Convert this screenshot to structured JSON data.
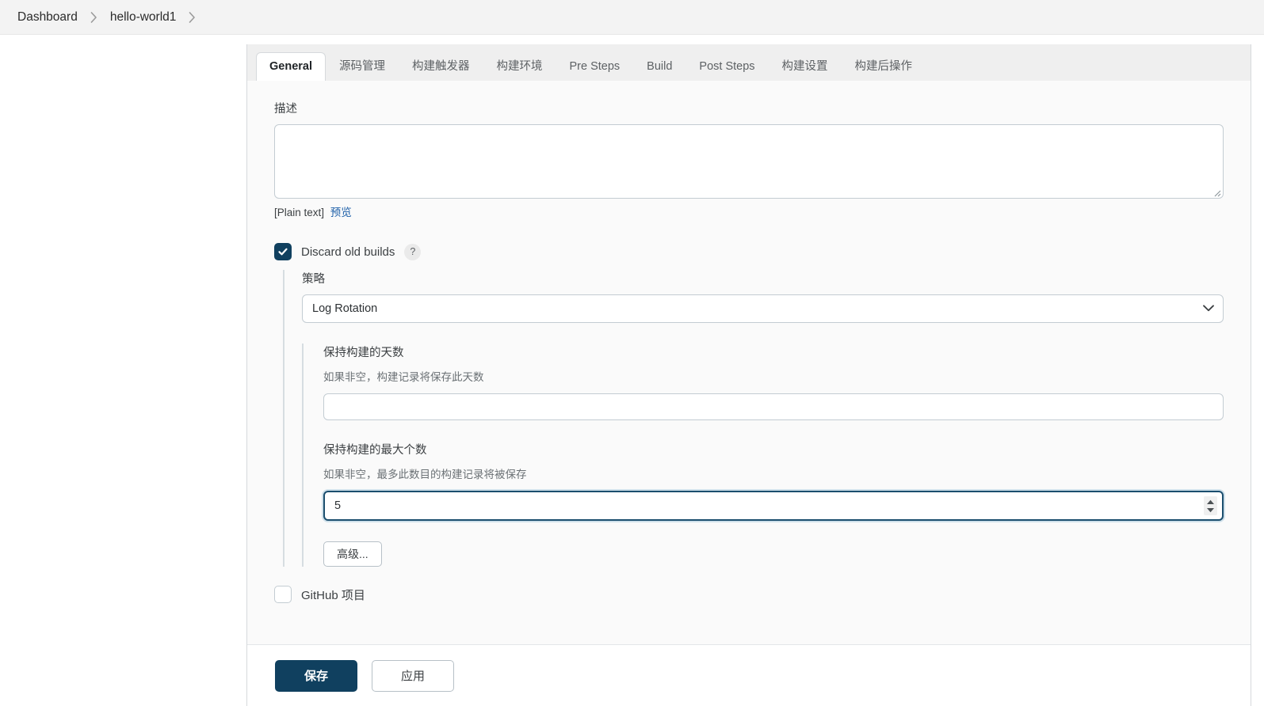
{
  "breadcrumb": {
    "items": [
      {
        "label": "Dashboard"
      },
      {
        "label": "hello-world1"
      }
    ]
  },
  "tabs": [
    {
      "label": "General",
      "active": true
    },
    {
      "label": "源码管理",
      "active": false
    },
    {
      "label": "构建触发器",
      "active": false
    },
    {
      "label": "构建环境",
      "active": false
    },
    {
      "label": "Pre Steps",
      "active": false
    },
    {
      "label": "Build",
      "active": false
    },
    {
      "label": "Post Steps",
      "active": false
    },
    {
      "label": "构建设置",
      "active": false
    },
    {
      "label": "构建后操作",
      "active": false
    }
  ],
  "form": {
    "description": {
      "label": "描述",
      "value": "",
      "placeholder": "",
      "plain_text_note": "[Plain text]",
      "preview_link": "预览"
    },
    "discard_old_builds": {
      "label": "Discard old builds",
      "checked": true,
      "help_glyph": "?"
    },
    "strategy": {
      "label": "策略",
      "selected": "Log Rotation",
      "options": [
        "Log Rotation"
      ]
    },
    "days_to_keep": {
      "label": "保持构建的天数",
      "description": "如果非空，构建记录将保存此天数",
      "value": "",
      "placeholder": ""
    },
    "max_builds_to_keep": {
      "label": "保持构建的最大个数",
      "description": "如果非空，最多此数目的构建记录将被保存",
      "value": "5",
      "placeholder": "",
      "focused": true
    },
    "advanced_button": "高级...",
    "github_project": {
      "label": "GitHub 项目",
      "checked": false
    }
  },
  "footer": {
    "save_label": "保存",
    "apply_label": "应用"
  },
  "colors": {
    "accent": "#10405f",
    "link": "#1d5fa8",
    "focus_ring": "#cfe0ea",
    "panel_bg": "#fafafa",
    "tabstrip_bg": "#efefef",
    "border": "#c3ccd2"
  }
}
